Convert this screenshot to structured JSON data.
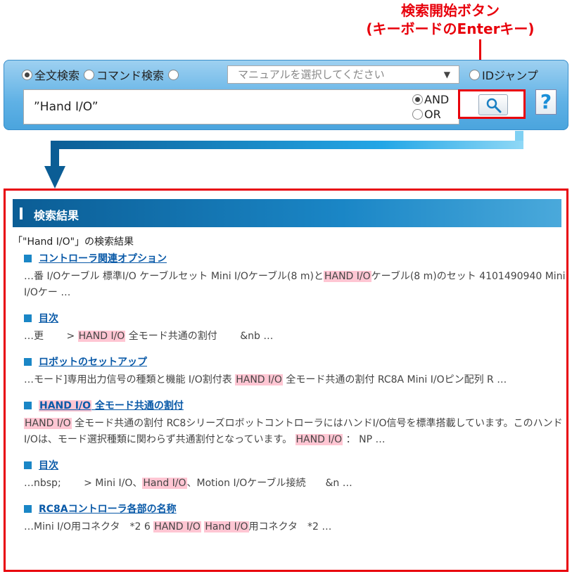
{
  "callout": {
    "line1": "検索開始ボタン",
    "line2": "(キーボードのEnterキー)"
  },
  "search": {
    "fulltext_label": "全文検索",
    "command_label": "コマンド検索",
    "manual_placeholder": "マニュアルを選択してください",
    "idjump_label": "IDジャンプ",
    "query": "”Hand I/O”",
    "and_label": "AND",
    "or_label": "OR",
    "help_label": "?"
  },
  "results": {
    "header": "検索結果",
    "summary": "「\"Hand I/O\"」の検索結果",
    "items": [
      {
        "title": [
          {
            "t": "コントローラ関連オプション"
          }
        ],
        "snippet": [
          {
            "t": "…番 I/Oケーブル 標準I/O ケーブルセット Mini I/Oケーブル(8 m)と"
          },
          {
            "t": "HAND I/O",
            "h": true
          },
          {
            "t": "ケーブル(8 m)のセット 4101490940 Mini I/Oケー …"
          }
        ]
      },
      {
        "title": [
          {
            "t": "目次"
          }
        ],
        "snippet": [
          {
            "t": "…更　　 > "
          },
          {
            "t": "HAND I/O",
            "h": true
          },
          {
            "t": " 全モード共通の割付　　 &nb …"
          }
        ]
      },
      {
        "title": [
          {
            "t": "ロボットのセットアップ"
          }
        ],
        "snippet": [
          {
            "t": "…モード]専用出力信号の種類と機能 I/O割付表 "
          },
          {
            "t": "HAND I/O",
            "h": true
          },
          {
            "t": " 全モード共通の割付 RC8A Mini I/Oピン配列 R …"
          }
        ]
      },
      {
        "title": [
          {
            "t": "HAND I/O",
            "h": true
          },
          {
            "t": " 全モード共通の割付"
          }
        ],
        "snippet": [
          {
            "t": "HAND I/O",
            "h": true
          },
          {
            "t": " 全モード共通の割付 RC8シリーズロボットコントローラにはハンドI/O信号を標準搭載しています。このハンドI/Oは、モード選択種類に関わらず共通割付となっています。 "
          },
          {
            "t": "HAND I/O",
            "h": true
          },
          {
            "t": " ： NP …"
          }
        ]
      },
      {
        "title": [
          {
            "t": "目次"
          }
        ],
        "snippet": [
          {
            "t": "…nbsp;　　 > Mini I/O、"
          },
          {
            "t": "Hand I/O",
            "h": true
          },
          {
            "t": "、Motion I/Oケーブル接続　　&n …"
          }
        ]
      },
      {
        "title": [
          {
            "t": "RC8Aコントローラ各部の名称"
          }
        ],
        "snippet": [
          {
            "t": "…Mini I/O用コネクタ　*2 6 "
          },
          {
            "t": "HAND I/O",
            "h": true
          },
          {
            "t": " "
          },
          {
            "t": "Hand I/O",
            "h": true
          },
          {
            "t": "用コネクタ　*2 …"
          }
        ]
      }
    ]
  }
}
